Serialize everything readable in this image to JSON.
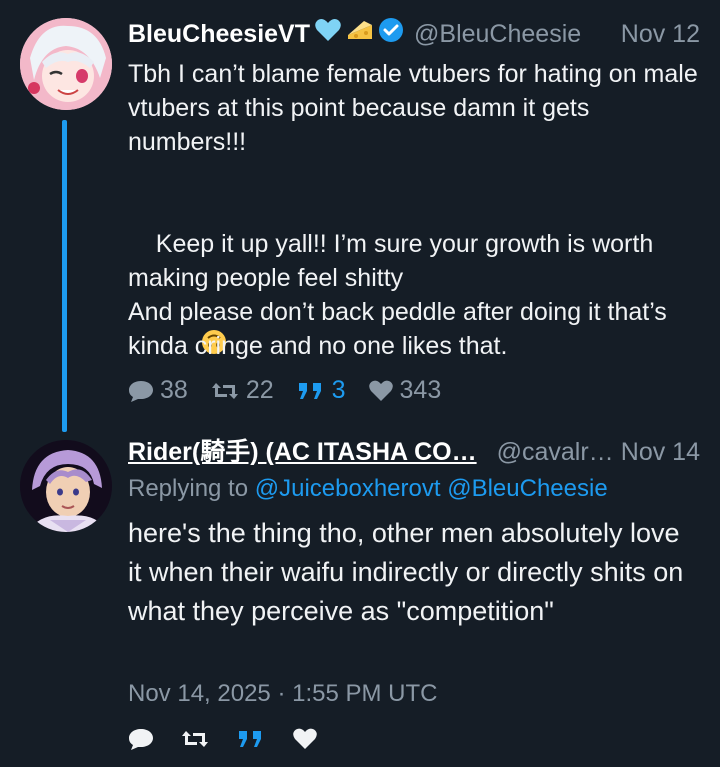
{
  "tweet1": {
    "display_name": "BleuCheesieVT",
    "name_emojis": [
      "light-blue-heart",
      "cheese",
      "verified-badge"
    ],
    "handle": "@BleuCheesie",
    "date": "Nov 12",
    "text_p1": "Tbh I can’t blame female vtubers for hating on male vtubers at this point because damn it gets numbers!!!",
    "text_p2": "Keep it up yall!! I’m sure your growth is worth making people feel shitty",
    "text_p2_emoji": "upside-down-face",
    "text_p3": "And please don’t back peddle after doing it that’s kinda cringe and no one likes that.",
    "stats": {
      "replies": "38",
      "retweets": "22",
      "quotes": "3",
      "likes": "343"
    }
  },
  "tweet2": {
    "display_name": "Rider(騎手) (AC ITASHA CO…",
    "handle": "@cavalr…",
    "date": "Nov 14",
    "replying_label": "Replying to",
    "mention1": "@Juiceboxherovt",
    "mention2": "@BleuCheesie",
    "text": "here's the thing tho, other men absolutely love it when their waifu indirectly or directly shits on what they perceive as \"competition\"",
    "timestamp": "Nov 14, 2025 · 1:55 PM UTC"
  },
  "colors": {
    "background": "#151d26",
    "accent": "#1d9bf0",
    "muted": "#8b98a5",
    "text": "#f1f3f5"
  }
}
